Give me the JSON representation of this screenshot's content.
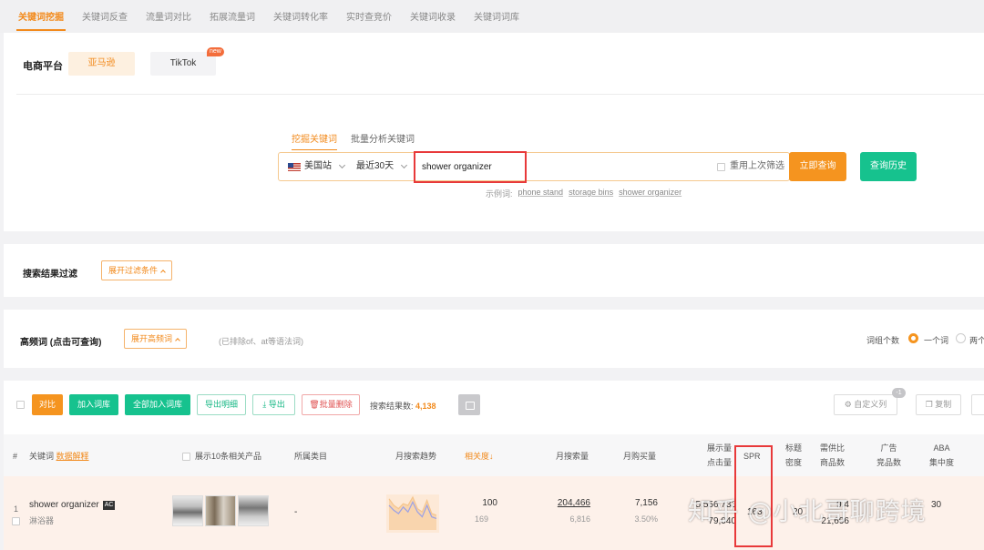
{
  "nav": {
    "tabs": [
      "关键词挖掘",
      "关键词反查",
      "流量词对比",
      "拓展流量词",
      "关键词转化率",
      "实时查竞价",
      "关键词收录",
      "关键词词库"
    ]
  },
  "platform": {
    "label": "电商平台",
    "amazon": "亚马逊",
    "tiktok": "TikTok",
    "new_badge": "new"
  },
  "search": {
    "mode_mine": "挖掘关键词",
    "mode_batch": "批量分析关键词",
    "site": "美国站",
    "period": "最近30天",
    "keyword": "shower organizer",
    "reuse_filter": "重用上次筛选",
    "query_button": "立即查询",
    "history_button": "查询历史",
    "examples_label": "示例词:",
    "examples": [
      "phone stand",
      "storage bins",
      "shower organizer"
    ]
  },
  "filter": {
    "label": "搜索结果过滤",
    "expand_button": "展开过滤条件"
  },
  "high_freq": {
    "label": "高频词 (点击可查询)",
    "expand_button": "展开高频词",
    "note": "(已排除of、at等语法词)",
    "word_count_label": "词组个数",
    "option_one": "一个词",
    "option_two": "两个"
  },
  "toolbar": {
    "compare": "对比",
    "add_library": "加入词库",
    "add_all_library": "全部加入词库",
    "export_detail": "导出明细",
    "export": "导出",
    "batch_delete": "批量删除",
    "result_count_label": "搜索结果数:",
    "result_count": "4,138",
    "custom_columns": "自定义列",
    "custom_badge": "-1",
    "copy": "复制"
  },
  "table": {
    "headers": {
      "index": "#",
      "keyword": "关键词",
      "keyword_link": "数据解释",
      "products": "展示10条相关产品",
      "category": "所属类目",
      "trend": "月搜索趋势",
      "relevance": "相关度",
      "monthly_search": "月搜索量",
      "monthly_purchase": "月购买量",
      "impressions_1": "展示量",
      "impressions_2": "点击量",
      "spr": "SPR",
      "title_density_1": "标题",
      "title_density_2": "密度",
      "supply_1": "需供比",
      "supply_2": "商品数",
      "ad_1": "广告",
      "ad_2": "竞品数",
      "aba_1": "ABA",
      "aba_2": "集中度"
    },
    "row": {
      "index": "1",
      "keyword": "shower organizer",
      "badge": "AC",
      "category_cn": "淋浴器",
      "category": "-",
      "relevance": "100",
      "relevance_sub": "169",
      "monthly_search": "204,466",
      "monthly_search_sub": "6,816",
      "monthly_purchase": "7,156",
      "purchase_rate": "3.50%",
      "impressions": "5,556,733",
      "clicks": "79,040",
      "spr": "163",
      "title_density": "20",
      "supply_ratio": "9.4",
      "product_count": "21,696",
      "aba": "30"
    }
  },
  "watermark": "知乎 @小北哥聊跨境",
  "chart_data": {
    "type": "line",
    "title": "",
    "series": [
      {
        "values": [
          38,
          30,
          26,
          32,
          30,
          40,
          26,
          22,
          36,
          20,
          18
        ]
      },
      {
        "values": [
          30,
          24,
          20,
          28,
          22,
          34,
          22,
          16,
          30,
          16,
          14
        ]
      }
    ],
    "colors": [
      "#f5c58c",
      "#9aa0e6"
    ]
  }
}
